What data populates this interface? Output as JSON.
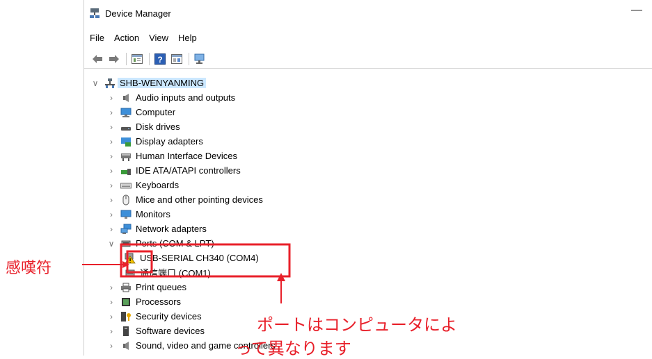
{
  "window": {
    "title": "Device Manager",
    "minimize_glyph": "—"
  },
  "menu": [
    "File",
    "Action",
    "View",
    "Help"
  ],
  "toolbar": [
    "back-icon",
    "forward-icon",
    "properties-icon",
    "help-icon",
    "update-driver-icon",
    "scan-hardware-icon"
  ],
  "tree": {
    "root": "SHB-WENYANMING",
    "categories": {
      "audio": "Audio inputs and outputs",
      "computer": "Computer",
      "disk": "Disk drives",
      "display": "Display adapters",
      "hid": "Human Interface Devices",
      "ide": "IDE ATA/ATAPI controllers",
      "keyboards": "Keyboards",
      "mice": "Mice and other pointing devices",
      "monitors": "Monitors",
      "network": "Network adapters",
      "ports": "Ports (COM & LPT)",
      "print": "Print queues",
      "processors": "Processors",
      "security": "Security devices",
      "software": "Software devices",
      "sound": "Sound, video and game controllers"
    },
    "ports_children": {
      "usb_serial": "USB-SERIAL CH340 (COM4)",
      "com1": "通信端口 (COM1)"
    }
  },
  "annotations": {
    "warning_label": "感嘆符",
    "port_note_line1": "ポートはコンピュータによ",
    "port_note_line2": "って異なります",
    "color": "#e8202a"
  }
}
